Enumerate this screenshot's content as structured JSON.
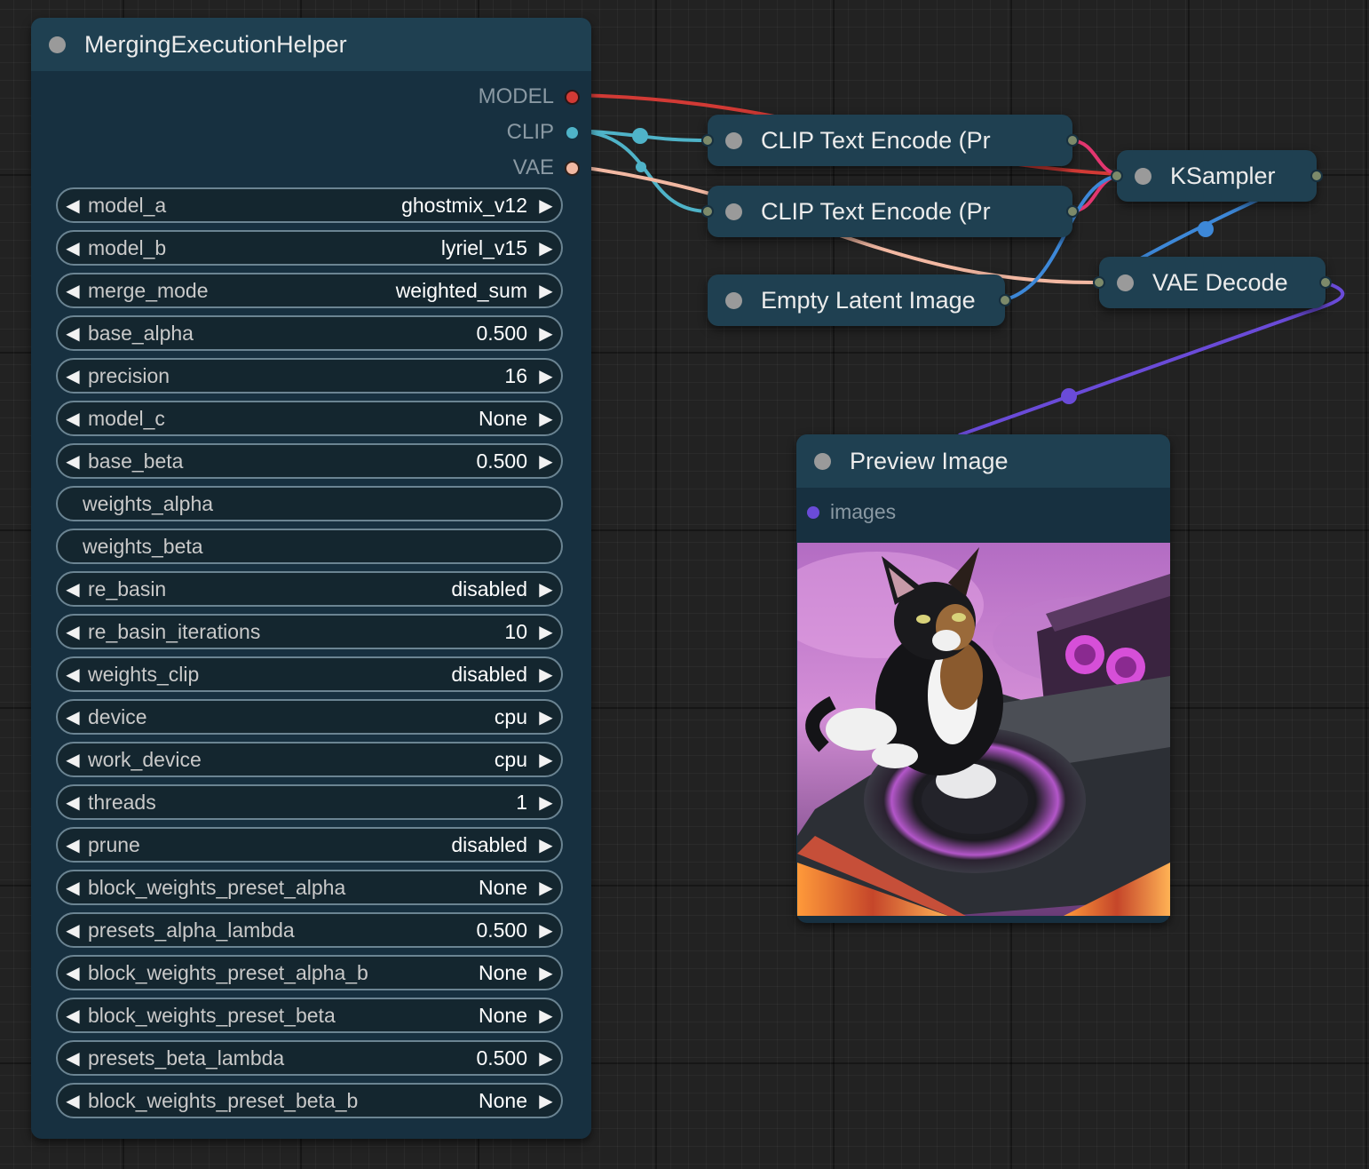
{
  "merge_node": {
    "title": "MergingExecutionHelper",
    "outputs": [
      {
        "label": "MODEL",
        "color": "#d23a35"
      },
      {
        "label": "CLIP",
        "color": "#4fb3c8"
      },
      {
        "label": "VAE",
        "color": "#f2b8a2"
      }
    ],
    "widgets": [
      {
        "label": "model_a",
        "value": "ghostmix_v12"
      },
      {
        "label": "model_b",
        "value": "lyriel_v15"
      },
      {
        "label": "merge_mode",
        "value": "weighted_sum"
      },
      {
        "label": "base_alpha",
        "value": "0.500"
      },
      {
        "label": "precision",
        "value": "16"
      },
      {
        "label": "model_c",
        "value": "None"
      },
      {
        "label": "base_beta",
        "value": "0.500"
      },
      {
        "label": "weights_alpha",
        "value": ""
      },
      {
        "label": "weights_beta",
        "value": ""
      },
      {
        "label": "re_basin",
        "value": "disabled"
      },
      {
        "label": "re_basin_iterations",
        "value": "10"
      },
      {
        "label": "weights_clip",
        "value": "disabled"
      },
      {
        "label": "device",
        "value": "cpu"
      },
      {
        "label": "work_device",
        "value": "cpu"
      },
      {
        "label": "threads",
        "value": "1"
      },
      {
        "label": "prune",
        "value": "disabled"
      },
      {
        "label": "block_weights_preset_alpha",
        "value": "None"
      },
      {
        "label": "presets_alpha_lambda",
        "value": "0.500"
      },
      {
        "label": "block_weights_preset_alpha_b",
        "value": "None"
      },
      {
        "label": "block_weights_preset_beta",
        "value": "None"
      },
      {
        "label": "presets_beta_lambda",
        "value": "0.500"
      },
      {
        "label": "block_weights_preset_beta_b",
        "value": "None"
      }
    ],
    "arrow_left": "◀",
    "arrow_right": "▶"
  },
  "clip_encode_1": {
    "title": "CLIP Text Encode (Pr"
  },
  "clip_encode_2": {
    "title": "CLIP Text Encode (Pr"
  },
  "empty_latent": {
    "title": "Empty Latent Image"
  },
  "ksampler": {
    "title": "KSampler"
  },
  "vae_decode": {
    "title": "VAE Decode"
  },
  "preview": {
    "title": "Preview Image",
    "input_label": "images",
    "input_color": "#6a4bd8"
  },
  "colors": {
    "background": "#222222",
    "node_body": "#173040",
    "node_title": "#1f4051",
    "link_model": "#d23a35",
    "link_clip": "#4fb3c8",
    "link_vae": "#f2b8a2",
    "link_latent": "#3d88d8",
    "link_conditioning": "#e2366f",
    "link_image": "#6a4bd8"
  }
}
